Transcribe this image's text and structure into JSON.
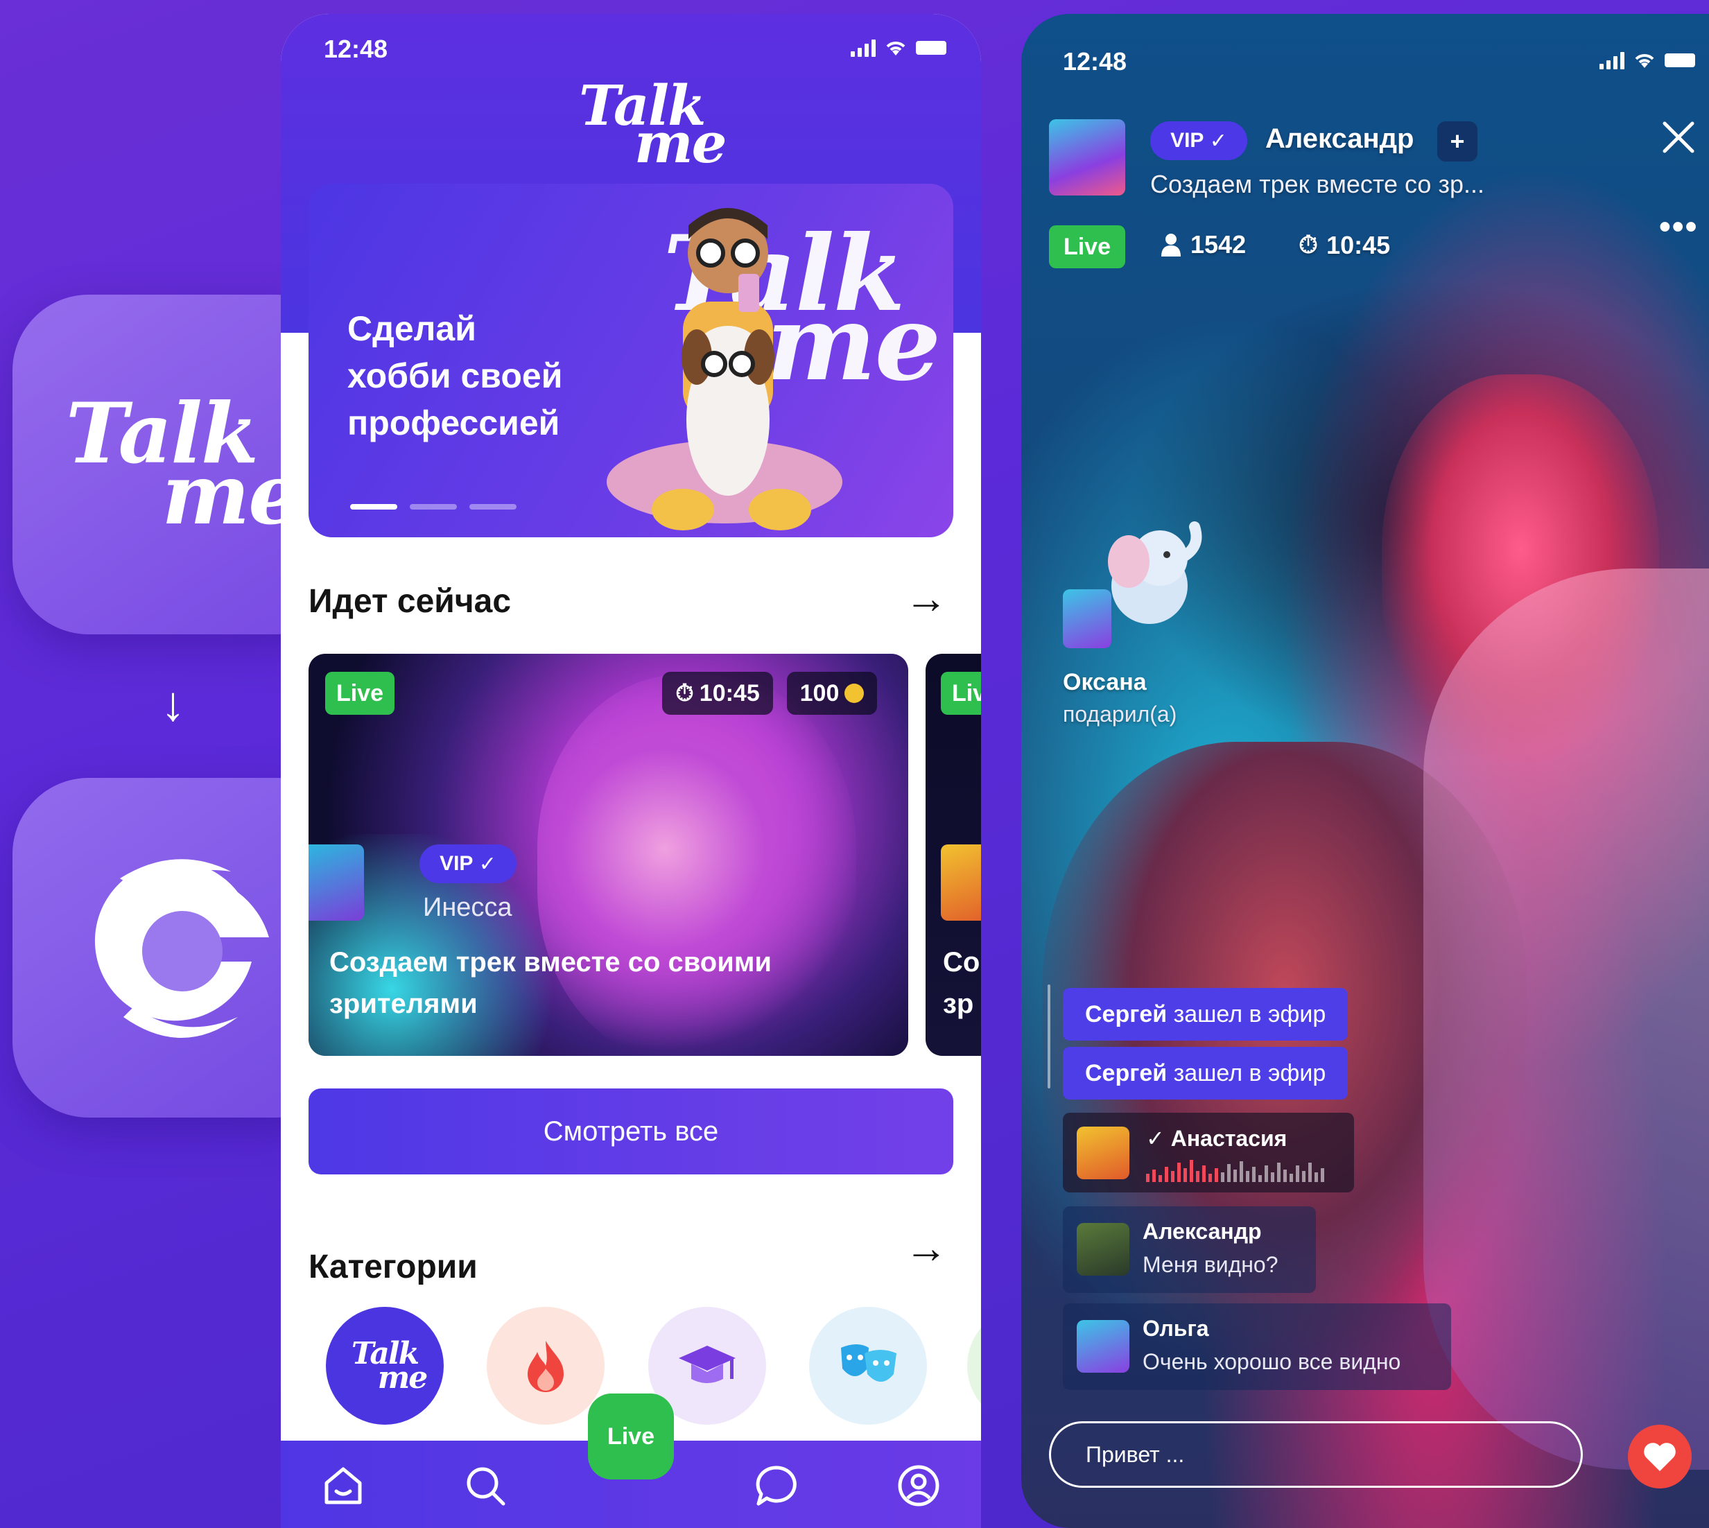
{
  "left_panel": {
    "brand_line1": "Talk",
    "brand_line2": "me",
    "arrow": "↓",
    "new_logo_icon": "g-logo-icon"
  },
  "phone1": {
    "status_time": "12:48",
    "header_logo_line1": "Talk",
    "header_logo_line2": "me",
    "banner": {
      "line1": "Сделай",
      "line2": "хобби своей",
      "line3": "профессией",
      "logo_line1": "Talk",
      "logo_line2": "me",
      "dots_active": 1,
      "dots_total": 3
    },
    "now_section": {
      "title": "Идет сейчас",
      "arrow": "→"
    },
    "stream_card": {
      "live": "Live",
      "timer": "10:45",
      "coins": "100",
      "vip": "VIP",
      "streamer": "Инесса",
      "title_line1": "Создаем трек вместе со своими",
      "title_line2": "зрителями"
    },
    "stream_card_2": {
      "live": "Live",
      "title_line1": "Со",
      "title_line2": "зр"
    },
    "watch_all_button": "Смотреть все",
    "categories_section": {
      "title": "Категории",
      "arrow": "→"
    },
    "categories": [
      {
        "icon": "talkme-logo-icon",
        "label": "Talk me",
        "bg": "#4a35e0"
      },
      {
        "icon": "fire-icon",
        "bg": "#fde4dc"
      },
      {
        "icon": "graduation-cap-icon",
        "bg": "#efe6fb"
      },
      {
        "icon": "theater-masks-icon",
        "bg": "#e3f1fb"
      }
    ],
    "tabbar": {
      "live_label": "Live",
      "tabs": [
        "home-icon",
        "search-icon",
        "live-icon",
        "chat-icon",
        "profile-icon"
      ]
    }
  },
  "phone2": {
    "status_time": "12:48",
    "host": {
      "vip": "VIP",
      "name": "Александр",
      "follow": "+",
      "stream_title": "Создаем трек вместе со зр..."
    },
    "stats": {
      "live": "Live",
      "viewers": "1542",
      "timer": "10:45"
    },
    "gift": {
      "name": "Оксана",
      "action": "подарил(а)",
      "icon": "elephant-gift-icon"
    },
    "events": [
      {
        "name": "Сергей",
        "text": "зашел в эфир"
      },
      {
        "name": "Сергей",
        "text": "зашел в эфир"
      }
    ],
    "voice_message": {
      "name": "Анастасия"
    },
    "messages": [
      {
        "name": "Александр",
        "text": "Меня видно?"
      },
      {
        "name": "Ольга",
        "text": "Очень хорошо все видно"
      }
    ],
    "input_placeholder": "Привет ...",
    "colors": {
      "accent": "#4d38e8",
      "live": "#2fbf4e",
      "heart": "#f0453f"
    }
  }
}
